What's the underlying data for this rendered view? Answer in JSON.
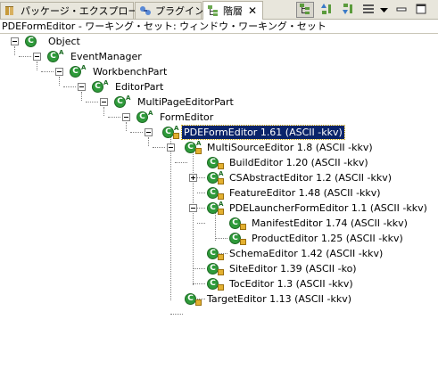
{
  "tabs": [
    {
      "label": "パッケージ・エクスプローラー",
      "icon": "package-explorer-icon",
      "active": false
    },
    {
      "label": "プラグイン",
      "icon": "plugins-icon",
      "active": false
    },
    {
      "label": "階層",
      "icon": "hierarchy-icon",
      "active": true,
      "close": "✕"
    }
  ],
  "toolbar": {
    "buttons": [
      {
        "name": "type-hierarchy-button",
        "icon": "type-hierarchy-icon",
        "pressed": true
      },
      {
        "name": "supertype-hierarchy-button",
        "icon": "supertype-hierarchy-icon",
        "pressed": false
      },
      {
        "name": "subtype-hierarchy-button",
        "icon": "subtype-hierarchy-icon",
        "pressed": false
      },
      {
        "name": "view-menu-button",
        "icon": "chevron-down-icon",
        "pressed": false
      },
      {
        "name": "minimize-button",
        "icon": "minimize-icon",
        "pressed": false
      },
      {
        "name": "maximize-button",
        "icon": "maximize-icon",
        "pressed": false
      }
    ]
  },
  "status_line": "PDEFormEditor - ワーキング・セット: ウィンドウ・ワーキング・セット",
  "tree": [
    {
      "label": "Object",
      "toggle": "minus"
    },
    {
      "label": "EventManager",
      "toggle": "minus",
      "abstract": true
    },
    {
      "label": "WorkbenchPart",
      "toggle": "minus",
      "abstract": true
    },
    {
      "label": "EditorPart",
      "toggle": "minus",
      "abstract": true
    },
    {
      "label": "MultiPageEditorPart",
      "toggle": "minus",
      "abstract": true
    },
    {
      "label": "FormEditor",
      "toggle": "minus",
      "abstract": true
    },
    {
      "label": "PDEFormEditor  1.61  (ASCII -kkv)",
      "toggle": "minus",
      "abstract": true,
      "selected": true
    },
    {
      "label": "MultiSourceEditor  1.8  (ASCII -kkv)",
      "toggle": "minus",
      "abstract": true
    },
    {
      "label": "BuildEditor  1.20  (ASCII -kkv)",
      "toggle": "none"
    },
    {
      "label": "CSAbstractEditor  1.2  (ASCII -kkv)",
      "toggle": "plus",
      "abstract": true
    },
    {
      "label": "FeatureEditor  1.48  (ASCII -kkv)",
      "toggle": "none"
    },
    {
      "label": "PDELauncherFormEditor  1.1  (ASCII -kkv)",
      "toggle": "minus",
      "abstract": true
    },
    {
      "label": "ManifestEditor  1.74  (ASCII -kkv)",
      "toggle": "none"
    },
    {
      "label": "ProductEditor  1.25  (ASCII -kkv)",
      "toggle": "none"
    },
    {
      "label": "SchemaEditor  1.42  (ASCII -kkv)",
      "toggle": "none"
    },
    {
      "label": "SiteEditor  1.39  (ASCII -ko)",
      "toggle": "none"
    },
    {
      "label": "TocEditor  1.3  (ASCII -kkv)",
      "toggle": "none"
    },
    {
      "label": "TargetEditor  1.13  (ASCII -kkv)",
      "toggle": "none"
    }
  ],
  "colors": {
    "class_icon": "#2e9a3a",
    "selection": "#0a246a",
    "tabbar": "#e8e6dc"
  }
}
